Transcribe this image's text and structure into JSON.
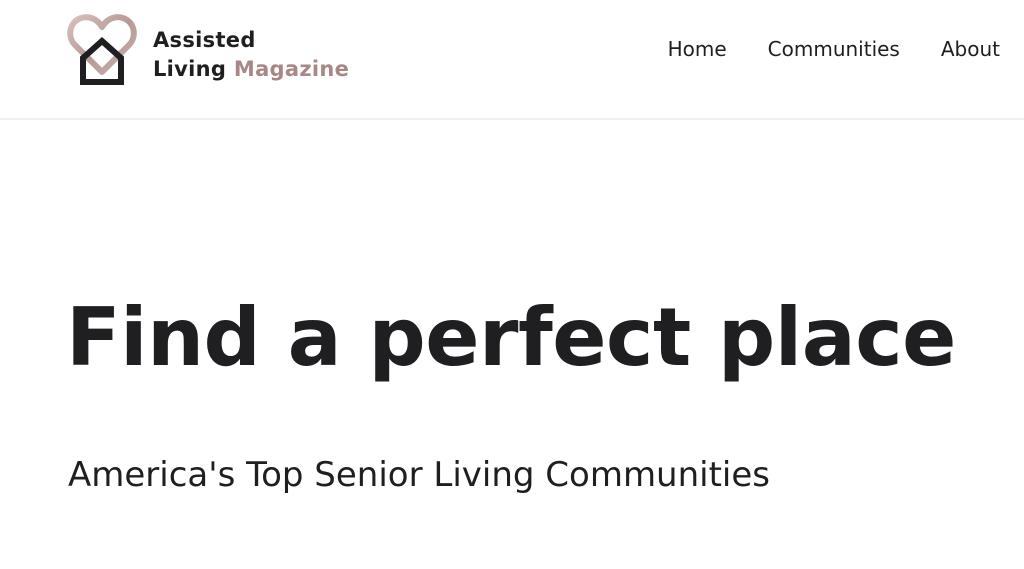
{
  "header": {
    "logo": {
      "line1": "Assisted",
      "line2_part1": "Living",
      "line2_part2": "Magazine",
      "icon": "heart-house-icon",
      "accent_color": "#a88787"
    },
    "nav": {
      "items": [
        {
          "label": "Home"
        },
        {
          "label": "Communities"
        },
        {
          "label": "About"
        }
      ]
    }
  },
  "hero": {
    "title": "Find a perfect place",
    "subtitle": "America's Top Senior Living Communities"
  },
  "colors": {
    "text": "#1f1f22",
    "brand_accent": "#a88787",
    "divider": "#eef0f6"
  }
}
